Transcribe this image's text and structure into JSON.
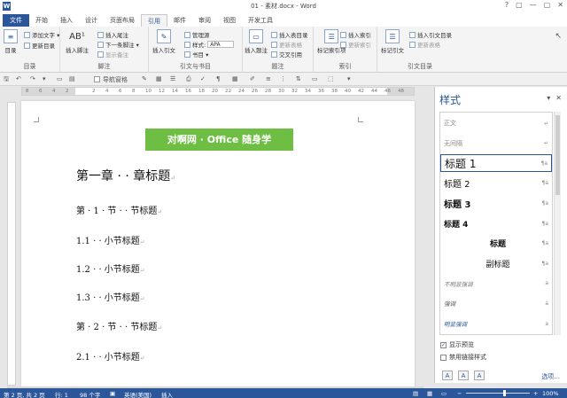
{
  "window": {
    "title": "01 - 素材.docx - Word",
    "icon_letter": "W",
    "controls": [
      "?",
      "▢",
      "—",
      "▢",
      "✕"
    ]
  },
  "tabs": [
    "文件",
    "开始",
    "插入",
    "设计",
    "页面布局",
    "引用",
    "邮件",
    "审阅",
    "视图",
    "开发工具"
  ],
  "active_tab": "引用",
  "ribbon": {
    "toc": {
      "label": "目录",
      "btn": "目录",
      "add_text": "添加文字 ▾",
      "update": "更新目录"
    },
    "footnote": {
      "label": "脚注",
      "insert": "插入脚注",
      "insert_endnote": "插入尾注",
      "next": "下一条脚注 ▾",
      "show": "显示备注",
      "ab": "AB¹"
    },
    "citation": {
      "label": "引文与书目",
      "insert": "插入引文",
      "manage": "管理源",
      "style_label": "样式:",
      "style_value": "APA",
      "bib": "书目 ▾"
    },
    "caption": {
      "label": "题注",
      "insert": "插入题注",
      "insert_table": "插入表目录",
      "update_table": "更新表格",
      "cross_ref": "交叉引用"
    },
    "index": {
      "label": "索引",
      "mark": "标记索引项",
      "insert": "插入索引",
      "update": "更新索引"
    },
    "authorities": {
      "label": "引文目录",
      "mark": "标记引文",
      "insert": "插入引文目录",
      "update": "更新表格"
    }
  },
  "qat": {
    "nav_pane": "导航窗格"
  },
  "ruler_ticks": [
    "8",
    "6",
    "4",
    "2",
    "",
    "2",
    "4",
    "6",
    "8",
    "10",
    "12",
    "14",
    "16",
    "18",
    "20",
    "22",
    "24",
    "26",
    "28",
    "30",
    "32",
    "34",
    "36",
    "38",
    "40",
    "42",
    "44",
    "46",
    "48"
  ],
  "document": {
    "banner": "对啊网 · Office 随身学",
    "headings": [
      {
        "text": "第一章 · · 章标题",
        "level": "h1"
      },
      {
        "text": "第 · 1 · 节 · · 节标题",
        "level": "h2"
      },
      {
        "text": "1.1 · · 小节标题",
        "level": "h3"
      },
      {
        "text": "1.2 · · 小节标题",
        "level": "h3"
      },
      {
        "text": "1.3 · · 小节标题",
        "level": "h3"
      },
      {
        "text": "第 · 2 · 节 · · 节标题",
        "level": "h2"
      },
      {
        "text": "2.1 · · 小节标题",
        "level": "h3"
      }
    ],
    "para_mark": "↵"
  },
  "styles_pane": {
    "title": "样式",
    "items": [
      {
        "name": "正文",
        "mark": "↵",
        "color": "#888888",
        "size": 7,
        "align": "left"
      },
      {
        "name": "无间隔",
        "mark": "↵",
        "color": "#888888",
        "size": 7,
        "align": "left"
      },
      {
        "name": "标题 1",
        "mark": "¶a",
        "color": "#111111",
        "size": 12,
        "align": "left"
      },
      {
        "name": "标题 2",
        "mark": "¶a",
        "color": "#111111",
        "size": 10,
        "align": "left"
      },
      {
        "name": "标题 3",
        "mark": "¶a",
        "color": "#111111",
        "size": 10,
        "align": "left",
        "bold": true
      },
      {
        "name": "标题 4",
        "mark": "¶a",
        "color": "#111111",
        "size": 9,
        "align": "left",
        "bold": true
      },
      {
        "name": "标题",
        "mark": "¶a",
        "color": "#111111",
        "size": 9,
        "align": "center",
        "bold": true
      },
      {
        "name": "副标题",
        "mark": "¶a",
        "color": "#111111",
        "size": 9,
        "align": "center"
      },
      {
        "name": "不明显强调",
        "mark": "a",
        "color": "#777777",
        "size": 6.5,
        "align": "left",
        "italic": true
      },
      {
        "name": "强调",
        "mark": "a",
        "color": "#555555",
        "size": 6.5,
        "align": "left",
        "italic": true
      },
      {
        "name": "明显强调",
        "mark": "a",
        "color": "#2b579a",
        "size": 6.5,
        "align": "left",
        "italic": true
      }
    ],
    "selected_index": 2,
    "show_preview": "显示预览",
    "disable_linked": "禁用链接样式",
    "options_link": "选项..."
  },
  "status": {
    "page": "第 2 页, 共 2 页",
    "line": "行: 1",
    "words": "98 个字",
    "lang": "英语(美国)",
    "mode": "插入",
    "zoom": "100%"
  },
  "colors": {
    "word_blue": "#2b579a",
    "banner_green": "#6ebe44"
  }
}
